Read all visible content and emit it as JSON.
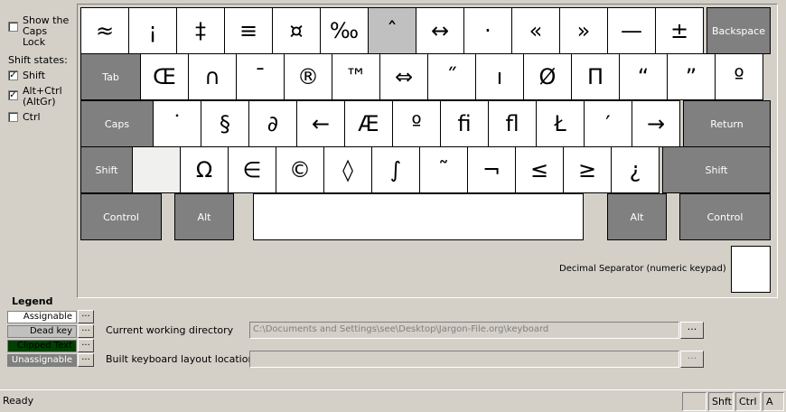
{
  "options": {
    "show_caps_lock": "Show the Caps Lock",
    "shift_states_label": "Shift states:",
    "shift": {
      "label": "Shift",
      "checked": true
    },
    "altgr": {
      "label": "Alt+Ctrl (AltGr)",
      "checked": true
    },
    "ctrl": {
      "label": "Ctrl",
      "checked": false
    }
  },
  "keyboard": {
    "row1": [
      "≈",
      "¡",
      "‡",
      "≡",
      "¤",
      "‰",
      "ˆ",
      "↔",
      "·",
      "«",
      "»",
      "—",
      "±"
    ],
    "row1_mod": "Backspace",
    "row2_mod": "Tab",
    "row2": [
      "Œ",
      "∩",
      "¯",
      "®",
      "™",
      "⇔",
      "˝",
      "ı",
      "Ø",
      "Π",
      "“",
      "”",
      "º"
    ],
    "row3_mod": "Caps",
    "row3": [
      "˙",
      "§",
      "∂",
      "←",
      "Æ",
      "º",
      "ﬁ",
      "ﬂ",
      "Ł",
      "′",
      "→"
    ],
    "row3_mod_right": "Return",
    "row4_mod": "Shift",
    "row4": [
      "",
      "Ω",
      "∈",
      "©",
      "◊",
      "∫",
      "˜",
      "¬",
      "≤",
      "≥",
      "¿"
    ],
    "row4_mod_right": "Shift",
    "row5": {
      "control_left": "Control",
      "alt_left": "Alt",
      "space": "",
      "alt_right": "Alt",
      "control_right": "Control"
    },
    "decimal_label": "Decimal Separator (numeric keypad)",
    "decimal_value": ""
  },
  "legend": {
    "title": "Legend",
    "items": [
      {
        "label": "Assignable",
        "bg": "#ffffff",
        "fg": "#000000"
      },
      {
        "label": "Dead key",
        "bg": "#c0c0c0",
        "fg": "#000000"
      },
      {
        "label": "Clipped Text",
        "bg": "#004000",
        "fg": "#000000"
      },
      {
        "label": "Unassignable",
        "bg": "#808080",
        "fg": "#ffffff"
      }
    ],
    "dots": "..."
  },
  "paths": {
    "cwd_label": "Current working directory",
    "cwd_value": "C:\\Documents and Settings\\see\\Desktop\\Jargon-File.org\\keyboard",
    "built_label": "Built keyboard layout location",
    "built_value": "",
    "browse": "..."
  },
  "status": {
    "text": "Ready",
    "blank": "",
    "shift": "Shft",
    "ctrl": "Ctrl",
    "alt": "A"
  }
}
